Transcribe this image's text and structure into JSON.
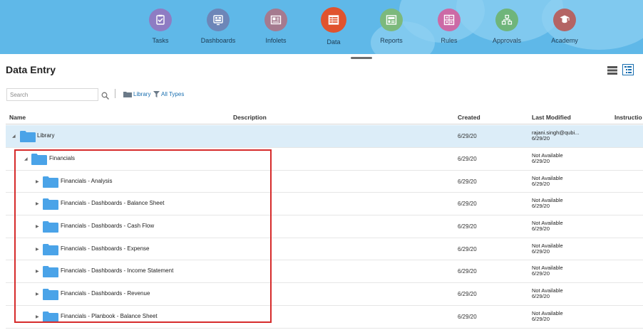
{
  "nav": {
    "items": [
      {
        "label": "Tasks",
        "icon": "clipboard-check-icon",
        "color": "#8e7cc3",
        "active": false
      },
      {
        "label": "Dashboards",
        "icon": "dashboard-icon",
        "color": "#6d86b8",
        "active": false
      },
      {
        "label": "Infolets",
        "icon": "infolets-icon",
        "color": "#a57a8f",
        "active": false
      },
      {
        "label": "Data",
        "icon": "data-grid-icon",
        "color": "#e0532e",
        "active": true
      },
      {
        "label": "Reports",
        "icon": "report-icon",
        "color": "#7cb97c",
        "active": false
      },
      {
        "label": "Rules",
        "icon": "calculator-icon",
        "color": "#cc6aa6",
        "active": false
      },
      {
        "label": "Approvals",
        "icon": "approvals-icon",
        "color": "#6fb57a",
        "active": false
      },
      {
        "label": "Academy",
        "icon": "academy-icon",
        "color": "#b46464",
        "active": false
      }
    ],
    "bar_color": "#5fb8e8"
  },
  "page": {
    "title": "Data Entry"
  },
  "toolbar": {
    "search_placeholder": "Search",
    "library_label": "Library",
    "types_label": "All Types",
    "link_color": "#1a6fb0"
  },
  "table": {
    "columns": {
      "name": "Name",
      "description": "Description",
      "created": "Created",
      "last_modified": "Last Modified",
      "instructions": "Instructio"
    },
    "rows": [
      {
        "name": "Library",
        "created": "6/29/20",
        "modified_by": "rajani.singh@qubi...",
        "modified_date": "6/29/20",
        "level": 0,
        "expanded": true,
        "selected": true
      },
      {
        "name": "Financials",
        "created": "6/29/20",
        "modified_by": "Not Available",
        "modified_date": "6/29/20",
        "level": 1,
        "expanded": true,
        "selected": false
      },
      {
        "name": "Financials - Analysis",
        "created": "6/29/20",
        "modified_by": "Not Available",
        "modified_date": "6/29/20",
        "level": 2,
        "expanded": false,
        "selected": false
      },
      {
        "name": "Financials - Dashboards - Balance Sheet",
        "created": "6/29/20",
        "modified_by": "Not Available",
        "modified_date": "6/29/20",
        "level": 2,
        "expanded": false,
        "selected": false
      },
      {
        "name": "Financials - Dashboards - Cash Flow",
        "created": "6/29/20",
        "modified_by": "Not Available",
        "modified_date": "6/29/20",
        "level": 2,
        "expanded": false,
        "selected": false
      },
      {
        "name": "Financials - Dashboards - Expense",
        "created": "6/29/20",
        "modified_by": "Not Available",
        "modified_date": "6/29/20",
        "level": 2,
        "expanded": false,
        "selected": false
      },
      {
        "name": "Financials - Dashboards - Income Statement",
        "created": "6/29/20",
        "modified_by": "Not Available",
        "modified_date": "6/29/20",
        "level": 2,
        "expanded": false,
        "selected": false
      },
      {
        "name": "Financials - Dashboards - Revenue",
        "created": "6/29/20",
        "modified_by": "Not Available",
        "modified_date": "6/29/20",
        "level": 2,
        "expanded": false,
        "selected": false
      },
      {
        "name": "Financials - Planbook - Balance Sheet",
        "created": "6/29/20",
        "modified_by": "Not Available",
        "modified_date": "6/29/20",
        "level": 2,
        "expanded": false,
        "selected": false
      }
    ],
    "folder_color": "#4aa3e8",
    "selected_row_color": "#dcedf8",
    "highlight_color": "#d62b2b"
  }
}
